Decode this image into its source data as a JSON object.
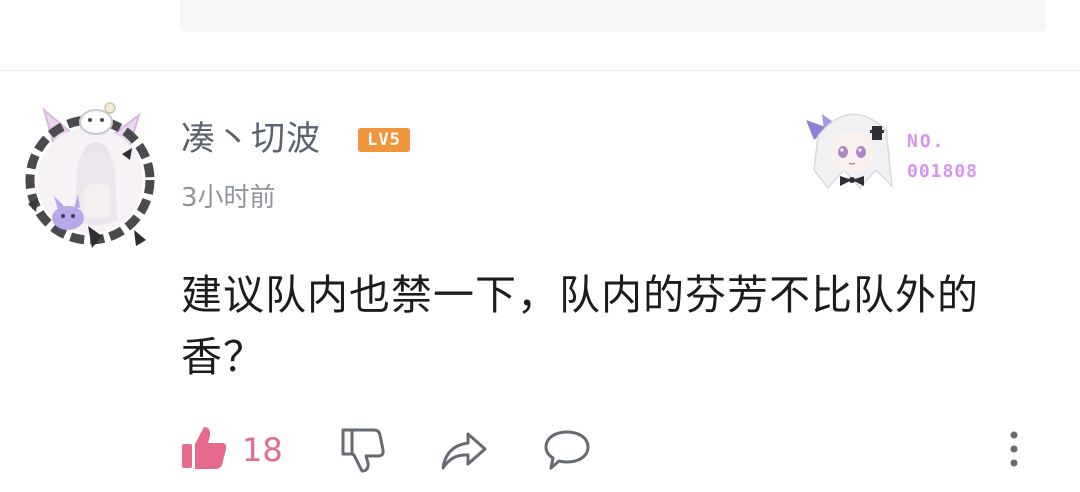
{
  "comment": {
    "username": "凑丶切波",
    "level": "LV5",
    "time": "3小时前",
    "text": "建议队内也禁一下，队内的芬芳不比队外的香？",
    "badge": {
      "no_label": "NO.",
      "number": "001808"
    }
  },
  "actions": {
    "like_count": "18",
    "like_color": "#e56a8c"
  },
  "colors": {
    "level_badge": "#f3953a",
    "badge_text": "#d893ea",
    "username": "#5b6270",
    "timestamp": "#8f949c"
  },
  "icons": {
    "like": "thumbs-up-icon",
    "dislike": "thumbs-down-icon",
    "share": "share-arrow-icon",
    "reply": "speech-bubble-icon",
    "more": "vertical-dots-icon"
  }
}
